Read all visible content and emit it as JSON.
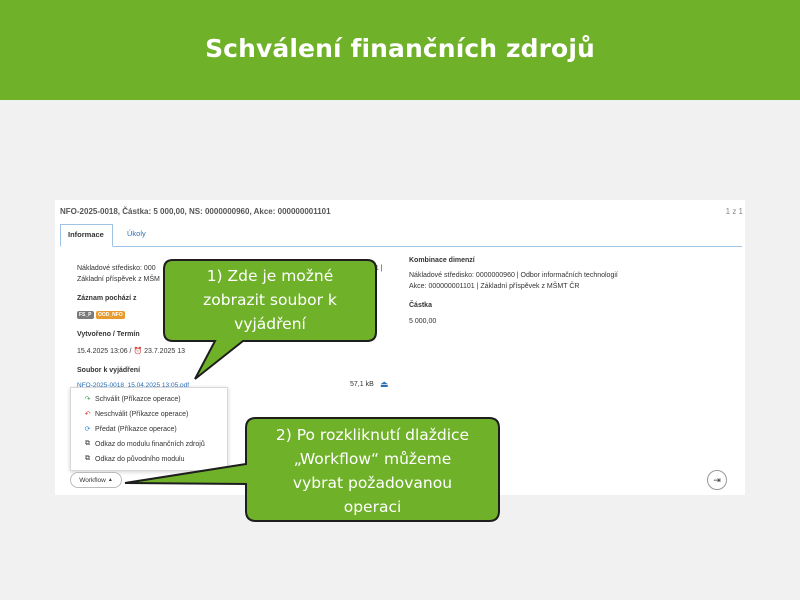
{
  "slide": {
    "title": "Schválení finančních zdrojů"
  },
  "screenshot": {
    "title": "NFO-2025-0018, Částka: 5 000,00, NS: 0000000960, Akce: 000000001101",
    "pager": "1 z 1",
    "tabs": [
      {
        "label": "Informace",
        "active": true
      },
      {
        "label": "Úkoly",
        "active": false
      }
    ],
    "left": {
      "cost_line1": "Nákladové středisko: 000",
      "cost_line1_tail": "01 |",
      "cost_line2": "Základní příspěvek z MŠM",
      "source_label": "Záznam pochází z",
      "badges": [
        {
          "text": "FS_P",
          "color": "#7a7a7a"
        },
        {
          "text": "OOD_NFO",
          "color": "#e89a2c"
        }
      ],
      "created_label": "Vytvořeno / Termín",
      "created_value": "15.4.2025 13:06 / ",
      "deadline_value": "23.7.2025 13",
      "file_label": "Soubor k vyjádření",
      "file_name": "NFO-2025-0018_15.04.2025 13:05.pdf",
      "file_size": "57,1 kB"
    },
    "right": {
      "combo_label": "Kombinace dimenzí",
      "combo_line1": "Nákladové středisko: 0000000960 | Odbor informačních technologií",
      "combo_line2": "Akce: 000000001101 | Základní příspěvek z MŠMT ČR",
      "amount_label": "Částka",
      "amount_value": "5 000,00"
    },
    "workflow_menu": [
      {
        "label": "Schválit (Příkazce operace)",
        "icon": "approve-arrow-icon",
        "glyph": "↷",
        "color": "#3aa548"
      },
      {
        "label": "Neschválit (Příkazce operace)",
        "icon": "reject-arrow-icon",
        "glyph": "↶",
        "color": "#d9342b"
      },
      {
        "label": "Předat (Příkazce operace)",
        "icon": "handover-cycle-icon",
        "glyph": "⟳",
        "color": "#3a8fd8"
      },
      {
        "label": "Odkaz do modulu finančních zdrojů",
        "icon": "external-link-icon",
        "glyph": "⧉",
        "color": "#333333"
      },
      {
        "label": "Odkaz do původního modulu",
        "icon": "external-link-icon",
        "glyph": "⧉",
        "color": "#333333"
      }
    ],
    "workflow_button": "Workflow",
    "exit_icon": "exit-icon"
  },
  "callouts": {
    "first": "1) Zde je možné zobrazit soubor k vyjádření",
    "first_lines": [
      "1) Zde je možné",
      "zobrazit soubor k",
      "vyjádření"
    ],
    "second": "2) Po rozkliknutí dlaždice „Workflow“ můžeme vybrat požadovanou operaci",
    "second_lines": [
      "2) Po rozkliknutí dlaždice",
      "„Workflow“ můžeme",
      "vybrat požadovanou",
      "operaci"
    ],
    "fill": "#6fb22a",
    "stroke": "#1e1e1e"
  },
  "colors": {
    "header_green": "#6fb22a",
    "link_blue": "#2a6fb6",
    "tab_border": "#9ec3e6"
  }
}
